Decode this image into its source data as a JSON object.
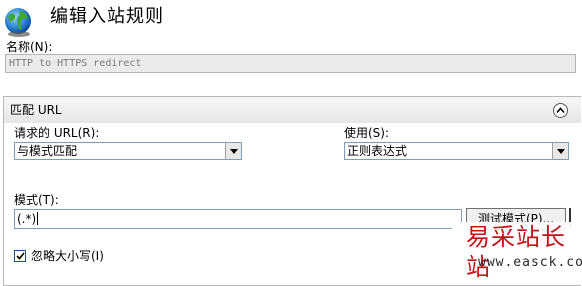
{
  "dialog": {
    "title": "编辑入站规则",
    "icon": "globe-icon"
  },
  "name": {
    "label": "名称(N):",
    "value": "HTTP to HTTPS redirect"
  },
  "match_section": {
    "title": "匹配 URL",
    "collapse_icon": "chevron-up-icon",
    "requested_url": {
      "label": "请求的 URL(R):",
      "value": "与模式匹配"
    },
    "using": {
      "label": "使用(S):",
      "value": "正则表达式"
    },
    "pattern": {
      "label": "模式(T):",
      "value": "(.*)"
    },
    "test_button": "测试模式(P)...",
    "ignore_case": {
      "label": "忽略大小写(I)",
      "checked": true
    }
  },
  "watermark": {
    "text": "易采站长站",
    "url": "www.easck.com",
    "color": "#c0151b"
  }
}
